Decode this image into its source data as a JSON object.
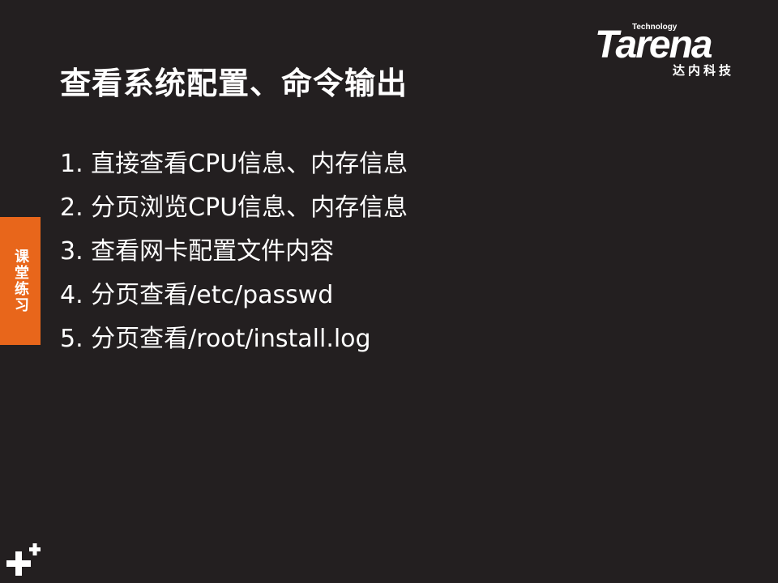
{
  "slide": {
    "title": "查看系统配置、命令输出",
    "side_tab": "课堂练习",
    "items": [
      "1. 直接查看CPU信息、内存信息",
      "2. 分页浏览CPU信息、内存信息",
      "3. 查看网卡配置文件内容",
      "4. 分页查看/etc/passwd",
      "5. 分页查看/root/install.log"
    ]
  },
  "logo": {
    "tagline": "Technology",
    "wordmark": "Tarena",
    "chinese_name": "达内科技"
  },
  "icons": {
    "corner": "plus-icon"
  },
  "colors": {
    "background": "#231f20",
    "accent": "#e8661b",
    "text": "#ffffff"
  }
}
